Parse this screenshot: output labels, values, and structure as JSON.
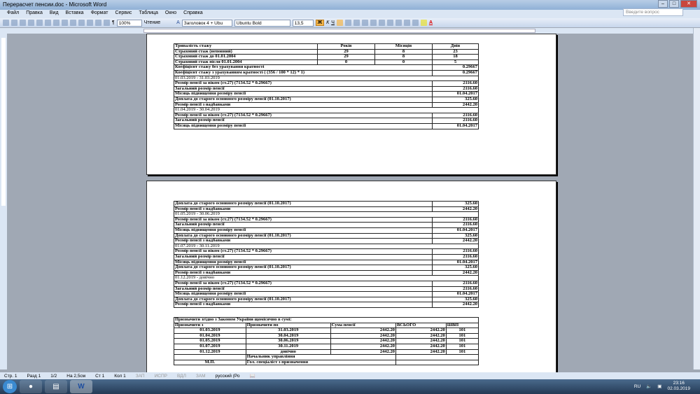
{
  "window": {
    "title": "Перерасчет пенсии.doc - Microsoft Word"
  },
  "menu": [
    "Файл",
    "Правка",
    "Вид",
    "Вставка",
    "Формат",
    "Сервис",
    "Таблица",
    "Окно",
    "Справка"
  ],
  "ask_placeholder": "Введите вопрос",
  "toolbar": {
    "zoom": "100%",
    "reading": "Чтение",
    "style": "Заголовок 4 + Ubu",
    "font": "Ubuntu Bold",
    "size": "13,5"
  },
  "stazh": {
    "headers": [
      "Тривалість стажу",
      "Років",
      "Місяців",
      "Днів"
    ],
    "rows": [
      [
        "Страховий стаж (неповний)",
        "29",
        "8",
        "23"
      ],
      [
        "Страховий стаж до 01.01.2004",
        "29",
        "8",
        "18"
      ],
      [
        "Страховий стаж після 01.01.2004",
        "0",
        "0",
        "5"
      ]
    ]
  },
  "coef": [
    [
      "Коефіцієнт стажу без урахування кратності",
      "0.29667"
    ],
    [
      "Коефіцієнт стажу з урахуванням кратності ( (356 / 100 * 12) * 1)",
      "0.29667"
    ]
  ],
  "page1_rows": [
    {
      "h": "01.03.2019 - 31.03.2019"
    },
    {
      "l": "Розмір пенсії за віком (ст.27) (7134.52 * 0.29667)",
      "v": "2116.60"
    },
    {
      "l": "Загальний розмір пенсії",
      "v": "2116.60"
    },
    {
      "l": "Місяць підвищення розміру пенсії",
      "v": "01.04.2017"
    },
    {
      "l": "Доплата до старого основного розміру пенсії (01.10.2017)",
      "v": "325.60"
    },
    {
      "l": "Розмір пенсії з надбавками",
      "v": "2442.20"
    },
    {
      "h": "01.04.2019 - 30.04.2019"
    },
    {
      "l": "Розмір пенсії за віком (ст.27) (7134.52 * 0.29667)",
      "v": "2116.60"
    },
    {
      "l": "Загальний розмір пенсії",
      "v": "2116.60"
    },
    {
      "l": "Місяць підвищення розміру пенсії",
      "v": "01.04.2017"
    }
  ],
  "page2_rows": [
    {
      "l": "Доплата до старого основного розміру пенсії (01.10.2017)",
      "v": "325.60"
    },
    {
      "l": "Розмір пенсії з надбавками",
      "v": "2442.20"
    },
    {
      "h": "01.05.2019 - 30.06.2019"
    },
    {
      "l": "Розмір пенсії за віком (ст.27) (7134.52 * 0.29667)",
      "v": "2116.60"
    },
    {
      "l": "Загальний розмір пенсії",
      "v": "2116.60"
    },
    {
      "l": "Місяць підвищення розміру пенсії",
      "v": "01.04.2017"
    },
    {
      "l": "Доплата до старого основного розміру пенсії (01.10.2017)",
      "v": "325.60"
    },
    {
      "l": "Розмір пенсії з надбавками",
      "v": "2442.20"
    },
    {
      "h": "01.07.2019 - 30.11.2019"
    },
    {
      "l": "Розмір пенсії за віком (ст.27) (7134.52 * 0.29667)",
      "v": "2116.60"
    },
    {
      "l": "Загальний розмір пенсії",
      "v": "2116.60"
    },
    {
      "l": "Місяць підвищення розміру пенсії",
      "v": "01.04.2017"
    },
    {
      "l": "Доплата до старого основного розміру пенсії (01.10.2017)",
      "v": "325.60"
    },
    {
      "l": "Розмір пенсії з надбавками",
      "v": "2442.20"
    },
    {
      "h": "01.12.2019 - довічно"
    },
    {
      "l": "Розмір пенсії за віком (ст.27) (7134.52 * 0.29667)",
      "v": "2116.60"
    },
    {
      "l": "Загальний розмір пенсії",
      "v": "2116.60"
    },
    {
      "l": "Місяць підвищення розміру пенсії",
      "v": "01.04.2017"
    },
    {
      "l": "Доплата до старого основного розміру пенсії (01.10.2017)",
      "v": "325.60"
    },
    {
      "l": "Розмір пенсії з надбавками",
      "v": "2442.20"
    }
  ],
  "assign": {
    "title": "Призначити згідно з Законом України щомісячно в сумі:",
    "headers": [
      "Призначити з",
      "Призначити по",
      "Сума пенсії",
      "ВСЬОГО",
      "ШВП"
    ],
    "rows": [
      [
        "01.03.2019",
        "31.03.2019",
        "2442.20",
        "2442.20",
        "101"
      ],
      [
        "01.04.2019",
        "30.04.2019",
        "2442.20",
        "2442.20",
        "101"
      ],
      [
        "01.05.2019",
        "30.06.2019",
        "2442.20",
        "2442.20",
        "101"
      ],
      [
        "01.07.2019",
        "30.11.2019",
        "2442.20",
        "2442.20",
        "101"
      ],
      [
        "01.12.2019",
        "довічно",
        "2442.20",
        "2442.20",
        "101"
      ]
    ],
    "head": "Начальник управління",
    "mp": "М.П.",
    "specialist": "Гол. спеціаліст з призначення"
  },
  "status": {
    "page": "Стр. 1",
    "section": "Разд 1",
    "pages": "1/2",
    "at": "На 2,5см",
    "line": "Ст 1",
    "col": "Кол 1",
    "rec": "ЗАП",
    "trk": "ИСПР",
    "ext": "ВДЛ",
    "ovr": "ЗАМ",
    "lang": "русский (Ро"
  },
  "tray": {
    "lang": "RU",
    "time": "23:16",
    "date": "02.03.2019"
  }
}
